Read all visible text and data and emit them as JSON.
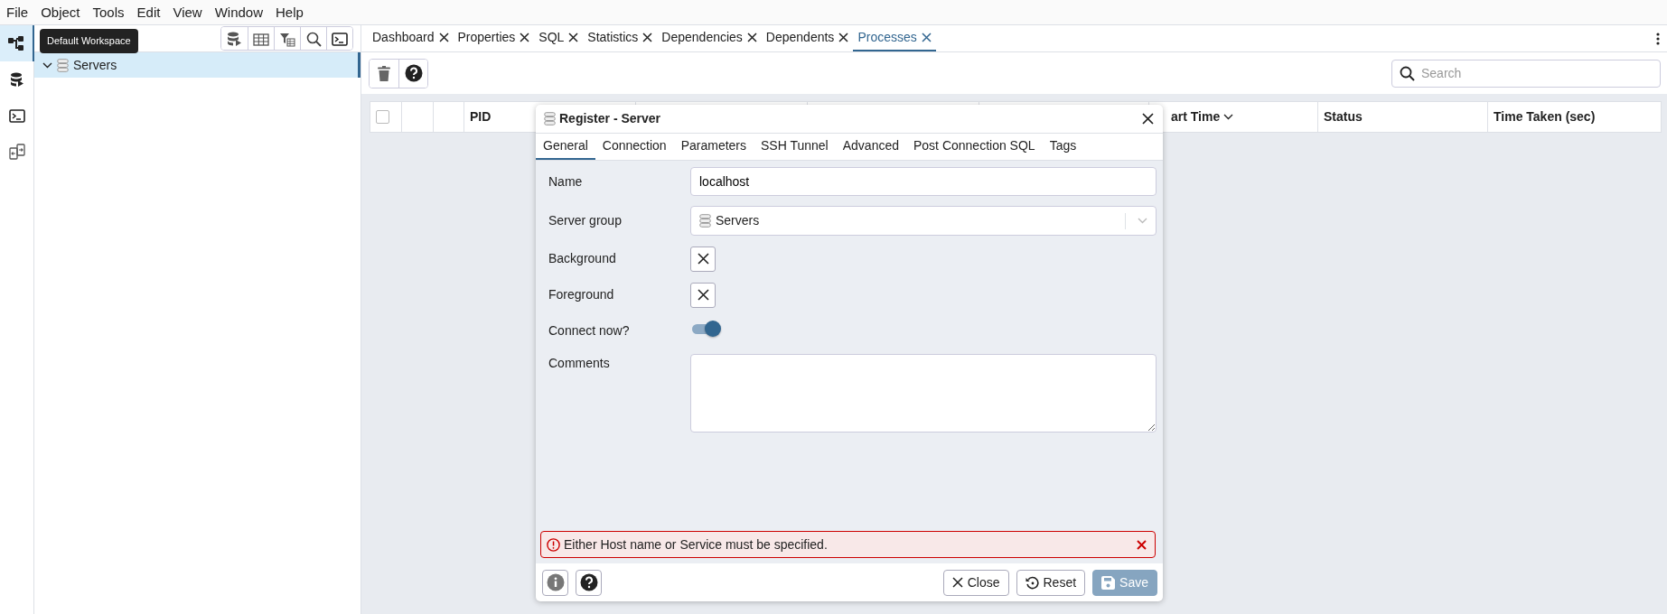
{
  "menu": [
    "File",
    "Object",
    "Tools",
    "Edit",
    "View",
    "Window",
    "Help"
  ],
  "sidebar_icons": [
    {
      "kind": "tree",
      "selected": true
    },
    {
      "kind": "database",
      "selected": false
    },
    {
      "kind": "terminal",
      "selected": false
    },
    {
      "kind": "compare",
      "selected": false
    }
  ],
  "tooltip": "Default Workspace",
  "tree": {
    "items": [
      {
        "label": "Servers",
        "expanded": true,
        "selected": true
      }
    ]
  },
  "tabs": [
    {
      "label": "Dashboard",
      "selected": false
    },
    {
      "label": "Properties",
      "selected": false
    },
    {
      "label": "SQL",
      "selected": false
    },
    {
      "label": "Statistics",
      "selected": false
    },
    {
      "label": "Dependencies",
      "selected": false
    },
    {
      "label": "Dependents",
      "selected": false
    },
    {
      "label": "Processes",
      "selected": true
    }
  ],
  "search": {
    "placeholder": "Search"
  },
  "grid": {
    "columns": [
      {
        "kind": "checkbox",
        "checked": false
      },
      {
        "kind": "blank"
      },
      {
        "kind": "blank"
      },
      {
        "kind": "text",
        "label": "PID"
      },
      {
        "kind": "blank"
      },
      {
        "kind": "blank"
      },
      {
        "kind": "blank"
      },
      {
        "kind": "text",
        "label": "art Time",
        "sorted": true
      },
      {
        "kind": "text",
        "label": "Status"
      },
      {
        "kind": "text",
        "label": "Time Taken (sec)"
      }
    ]
  },
  "dialog": {
    "title": "Register - Server",
    "tabs": [
      {
        "label": "General",
        "selected": true
      },
      {
        "label": "Connection",
        "selected": false
      },
      {
        "label": "Parameters",
        "selected": false
      },
      {
        "label": "SSH Tunnel",
        "selected": false
      },
      {
        "label": "Advanced",
        "selected": false
      },
      {
        "label": "Post Connection SQL",
        "selected": false
      },
      {
        "label": "Tags",
        "selected": false
      }
    ],
    "fields": [
      {
        "kind": "text",
        "label": "Name",
        "value": "localhost"
      },
      {
        "kind": "select",
        "label": "Server group",
        "value": "Servers"
      },
      {
        "kind": "color",
        "label": "Background"
      },
      {
        "kind": "color",
        "label": "Foreground"
      },
      {
        "kind": "switch",
        "label": "Connect now?",
        "on": true
      },
      {
        "kind": "textarea",
        "label": "Comments"
      }
    ],
    "error": "Either Host name or Service must be specified.",
    "buttons": [
      {
        "kind": "close",
        "label": "Close",
        "disabled": false
      },
      {
        "kind": "reset",
        "label": "Reset",
        "disabled": false
      },
      {
        "kind": "save",
        "label": "Save",
        "disabled": true
      }
    ]
  }
}
